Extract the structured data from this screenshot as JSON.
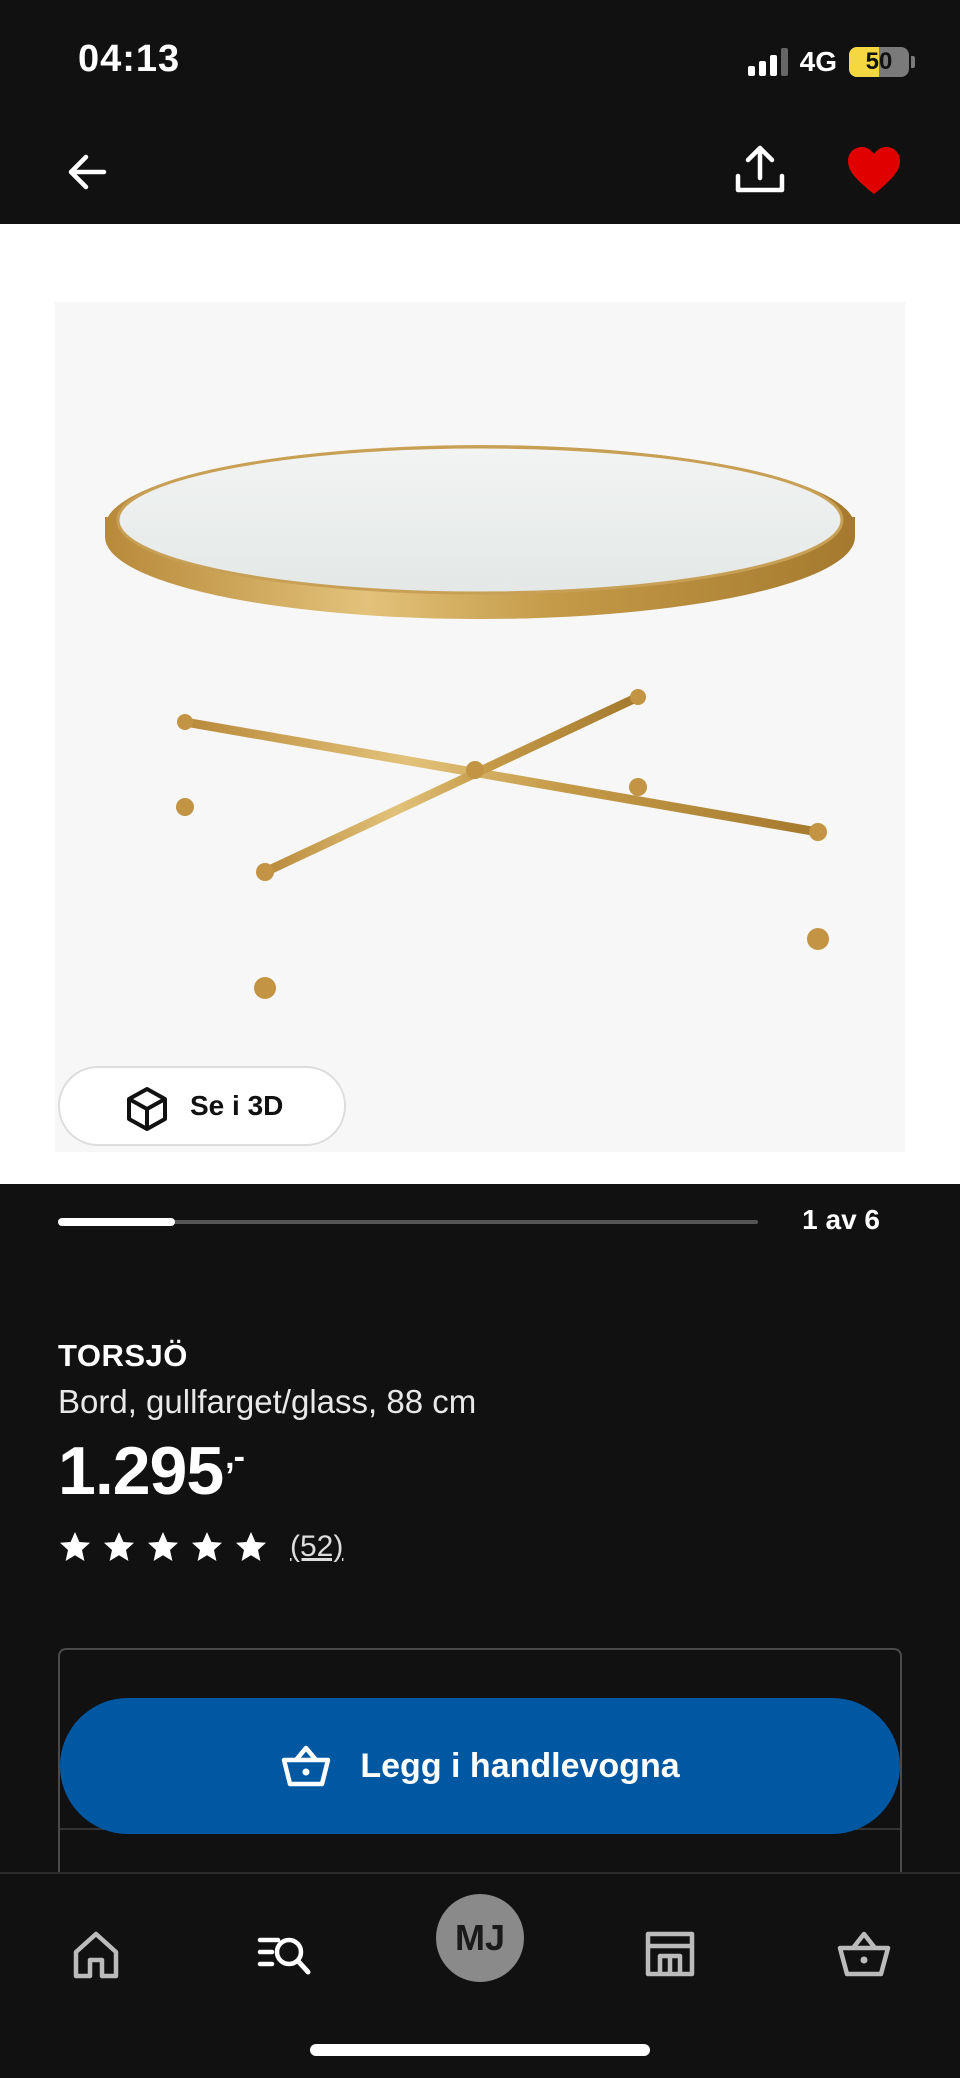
{
  "status_bar": {
    "time": "04:13",
    "network": "4G",
    "battery": "50",
    "battery_level_percent": 50
  },
  "top_nav": {
    "back_icon": "arrow-left-icon",
    "share_icon": "share-upload-icon",
    "favorite_icon": "heart-filled-icon",
    "favorite_color": "#e00000"
  },
  "gallery": {
    "view_3d_label": "Se i 3D",
    "view_3d_icon": "cube-icon",
    "position_label": "1 av 6",
    "current_index": 1,
    "total": 6
  },
  "product": {
    "name": "TORSJÖ",
    "description": "Bord, gullfarget/glass, 88 cm",
    "price": "1.295",
    "price_suffix": ",-",
    "rating_stars": 5,
    "review_count": "(52)"
  },
  "actions": {
    "add_to_cart_label": "Legg i handlevogna",
    "add_to_cart_icon": "basket-icon",
    "accent_color": "#0058a3"
  },
  "bottom_nav": {
    "items": [
      {
        "icon": "home-icon"
      },
      {
        "icon": "search-list-icon"
      },
      {
        "avatar_initials": "MJ"
      },
      {
        "icon": "store-icon"
      },
      {
        "icon": "basket-icon"
      }
    ]
  }
}
